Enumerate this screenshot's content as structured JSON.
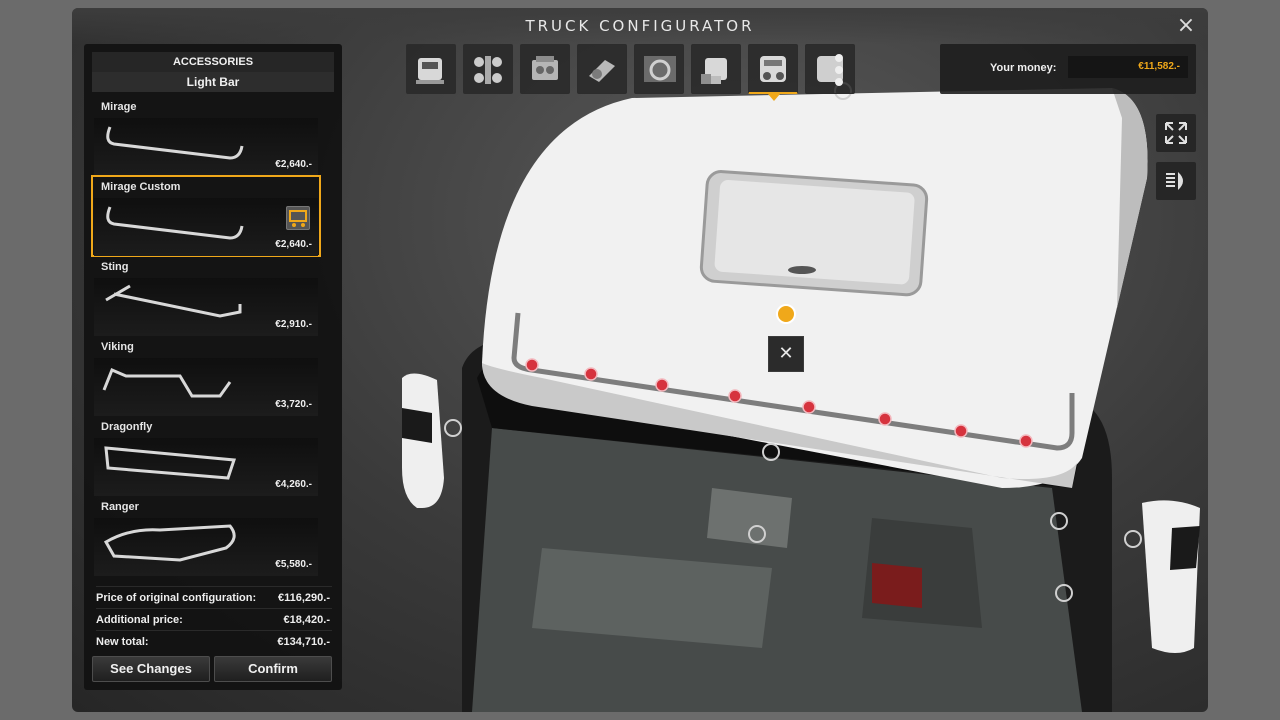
{
  "window": {
    "title": "TRUCK CONFIGURATOR",
    "close_icon": "×"
  },
  "panel": {
    "header": "ACCESSORIES",
    "subheader": "Light Bar",
    "items": [
      {
        "name": "Mirage",
        "price": "€2,640.-",
        "shape": "mirage"
      },
      {
        "name": "Mirage Custom",
        "price": "€2,640.-",
        "shape": "mirage",
        "selected": true
      },
      {
        "name": "Sting",
        "price": "€2,910.-",
        "shape": "sting"
      },
      {
        "name": "Viking",
        "price": "€3,720.-",
        "shape": "viking"
      },
      {
        "name": "Dragonfly",
        "price": "€4,260.-",
        "shape": "dragonfly"
      },
      {
        "name": "Ranger",
        "price": "€5,580.-",
        "shape": "ranger"
      }
    ],
    "totals": [
      {
        "label": "Price of original configuration:",
        "value": "€116,290.-"
      },
      {
        "label": "Additional price:",
        "value": "€18,420.-"
      },
      {
        "label": "New total:",
        "value": "€134,710.-"
      }
    ],
    "see_changes": "See Changes",
    "confirm": "Confirm"
  },
  "tabs": [
    {
      "icon": "cabin-icon"
    },
    {
      "icon": "chassis-icon"
    },
    {
      "icon": "engine-icon"
    },
    {
      "icon": "transmission-icon"
    },
    {
      "icon": "interior-icon"
    },
    {
      "icon": "paint-icon"
    },
    {
      "icon": "accessories-icon",
      "active": true
    },
    {
      "icon": "accessories-2-icon"
    }
  ],
  "money": {
    "label": "Your money:",
    "value": "€11,582.-"
  },
  "colors": {
    "accent": "#f0a81a",
    "highlight_dot": "#f0a81a",
    "mount_dot": "#d6333e"
  },
  "remove_icon": "✕"
}
